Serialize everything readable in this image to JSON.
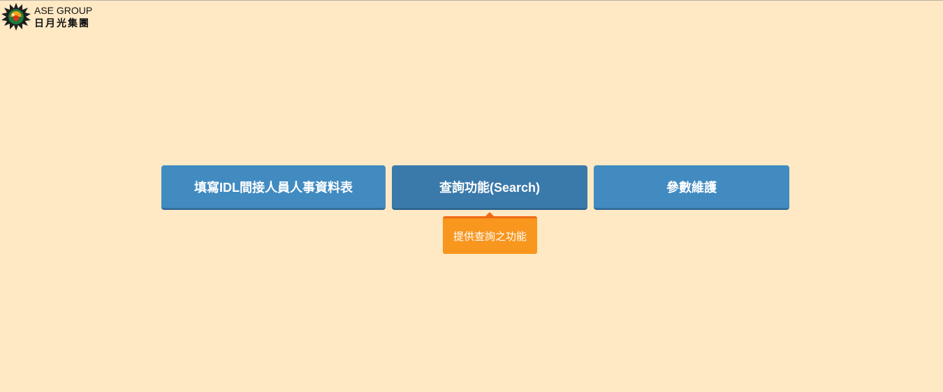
{
  "header": {
    "logo": {
      "text_en": "ASE GROUP",
      "text_zh": "日月光集團",
      "icon": "ase-star-logo-icon"
    }
  },
  "menu": {
    "buttons": [
      {
        "label": "填寫IDL間接人員人事資料表",
        "active": false
      },
      {
        "label": "查詢功能(Search)",
        "active": true
      },
      {
        "label": "參數維護",
        "active": false
      }
    ],
    "tooltip": "提供查詢之功能"
  },
  "colors": {
    "background": "#ffe9c5",
    "button": "#418bc1",
    "button_active": "#3a7aab",
    "tooltip": "#f8961e",
    "tooltip_border": "#f06a12"
  }
}
